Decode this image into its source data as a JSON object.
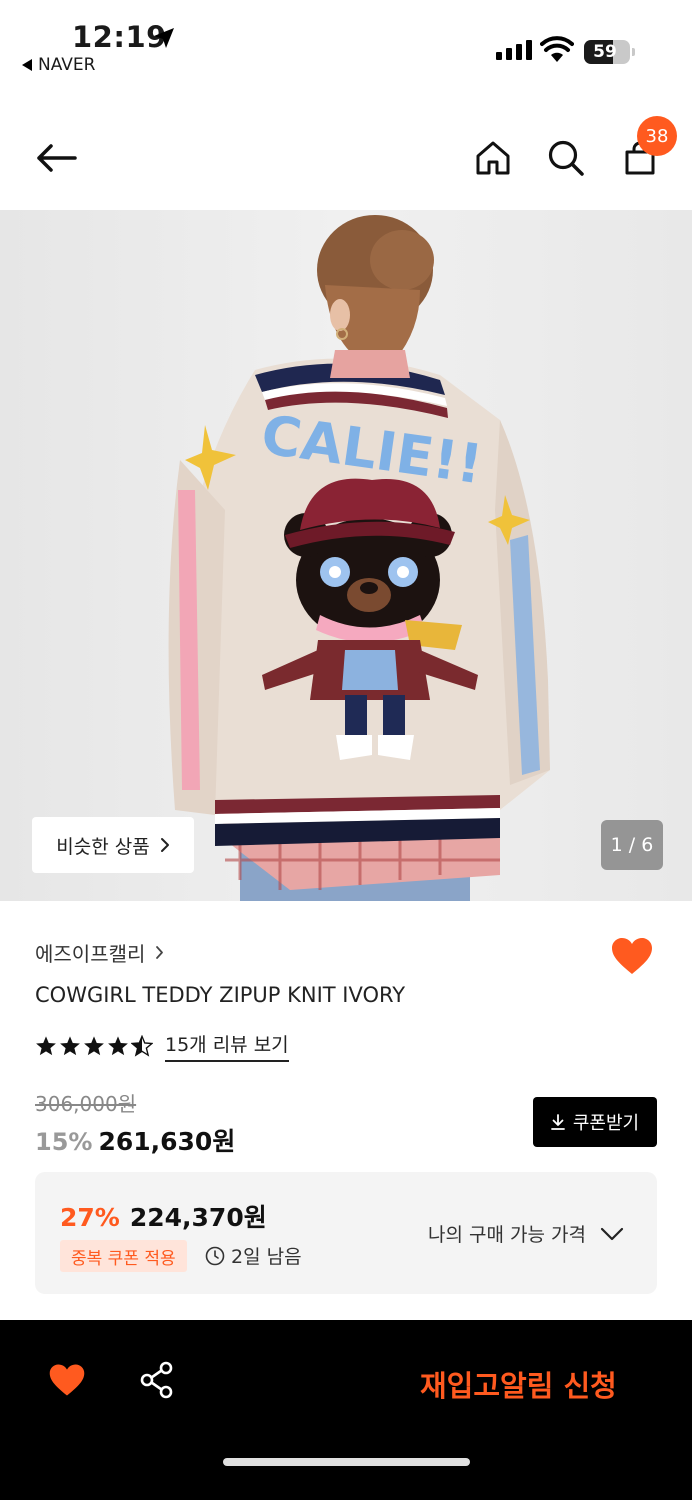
{
  "status_bar": {
    "time": "12:19",
    "back_app": "NAVER",
    "battery": "59"
  },
  "nav": {
    "cart_count": "38"
  },
  "hero": {
    "similar_label": "비슷한 상품",
    "counter": "1 / 6"
  },
  "product": {
    "brand": "에즈이프캘리",
    "name": "COWGIRL TEDDY ZIPUP KNIT IVORY",
    "rating_stars": 4.5,
    "review_link": "15개 리뷰 보기",
    "original_price": "306,000원",
    "discount": "15%",
    "sale_price": "261,630원",
    "coupon_label": "쿠폰받기"
  },
  "best_price": {
    "discount": "27%",
    "price": "224,370원",
    "tag": "중복 쿠폰 적용",
    "remaining": "2일 남음",
    "my_price_label": "나의 구매 가능 가격"
  },
  "bottom_bar": {
    "restock_label": "재입고알림 신청"
  },
  "colors": {
    "accent": "#ff5a1f",
    "bar": "#000000"
  }
}
